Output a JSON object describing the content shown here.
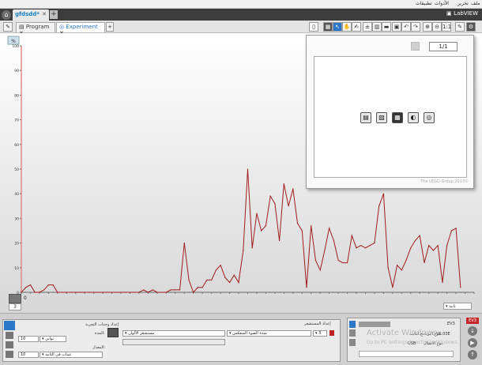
{
  "menubar": {
    "items": [
      "ملف",
      "تحرير",
      "الأدوات",
      "تطبيقات"
    ]
  },
  "project": {
    "tab_label": "gfdsdd*",
    "close_glyph": "✕",
    "add_glyph": "+",
    "app_logo": "LabVIEW"
  },
  "subtabs": [
    {
      "label": "Program",
      "close": "✕"
    },
    {
      "label": "Experiment",
      "close": "✕"
    }
  ],
  "subtab_add": "+",
  "chart_data": {
    "type": "line",
    "ylabel": "%",
    "ylim": [
      0,
      100
    ],
    "yticks": [
      0,
      10,
      20,
      30,
      40,
      50,
      60,
      70,
      80,
      90,
      100
    ],
    "x_tick_first": "0",
    "xlim": [
      0,
      100
    ],
    "x": [
      0,
      1,
      2,
      3,
      4,
      5,
      6,
      7,
      8,
      9,
      10,
      11,
      12,
      13,
      14,
      15,
      16,
      17,
      18,
      19,
      20,
      21,
      22,
      23,
      24,
      25,
      26,
      27,
      28,
      29,
      30,
      31,
      32,
      33,
      34,
      35,
      36,
      37,
      38,
      39,
      40,
      41,
      42,
      43,
      44,
      45,
      46,
      47,
      48,
      49,
      50,
      51,
      52,
      53,
      54,
      55,
      56,
      57,
      58,
      59,
      60,
      61,
      62,
      63,
      64,
      65,
      66,
      67,
      68,
      69,
      70,
      71,
      72,
      73,
      74,
      75,
      76,
      77,
      78,
      79,
      80,
      81,
      82,
      83,
      84,
      85,
      86,
      87,
      88,
      89,
      90,
      91,
      92,
      93,
      94,
      95,
      96,
      97,
      98,
      99,
      100
    ],
    "series": [
      {
        "color": "#a01c1c",
        "values": [
          0,
          2,
          3,
          0,
          0,
          1,
          3,
          3,
          0,
          0,
          0,
          0,
          0,
          0,
          0,
          0,
          0,
          0,
          0,
          0,
          0,
          0,
          0,
          0,
          0,
          0,
          0,
          1,
          0,
          1,
          0,
          0,
          0,
          1,
          1,
          1,
          20,
          5,
          0,
          2,
          2,
          5,
          5,
          9,
          11,
          6,
          4,
          7,
          4,
          17,
          50,
          18,
          32,
          25,
          27,
          39,
          36,
          21,
          44,
          35,
          42,
          28,
          25,
          2,
          27,
          13,
          9,
          17,
          26,
          21,
          13,
          12,
          12,
          23,
          18,
          19,
          18,
          19,
          20,
          35,
          40,
          10,
          2,
          11,
          9,
          13,
          18,
          21,
          23,
          12,
          19,
          17,
          19,
          4,
          19,
          25,
          26,
          2
        ]
      }
    ]
  },
  "chart_bottom": {
    "value_label": "3",
    "unit_dropdown": "ثانية"
  },
  "popup": {
    "page": "1/1",
    "credit": "The LEGO Group 2013©",
    "icons": [
      "document-icon",
      "image-icon",
      "film-icon",
      "sound-icon",
      "target-icon"
    ]
  },
  "left_panel": {
    "setup_title": "إعداد وحدات التجربة",
    "sensor_title": "إعداد المستشعر",
    "mode_label": "المدة:",
    "mode_value": "10",
    "mode_unit": "ثواني",
    "rate_label": "المعدل:",
    "rate_value": "10",
    "rate_unit": "عينات في الثانية",
    "port_value": "3",
    "sensor_dropdown": "شدة الضوء المنعكس",
    "sensor_dropdown_2": "مستشعر الألوان"
  },
  "right_panel": {
    "brick_name": "EV3",
    "version_label": "فرع البرنامج الثابت:",
    "version_value": "V1.03E",
    "connection_label": "نوع الاتصال:",
    "connection_value": "USB",
    "watermark_title": "Activate Windows",
    "watermark_sub": "Go to PC settings to activate Windows."
  },
  "ev3_side": {
    "label": "EV3"
  }
}
